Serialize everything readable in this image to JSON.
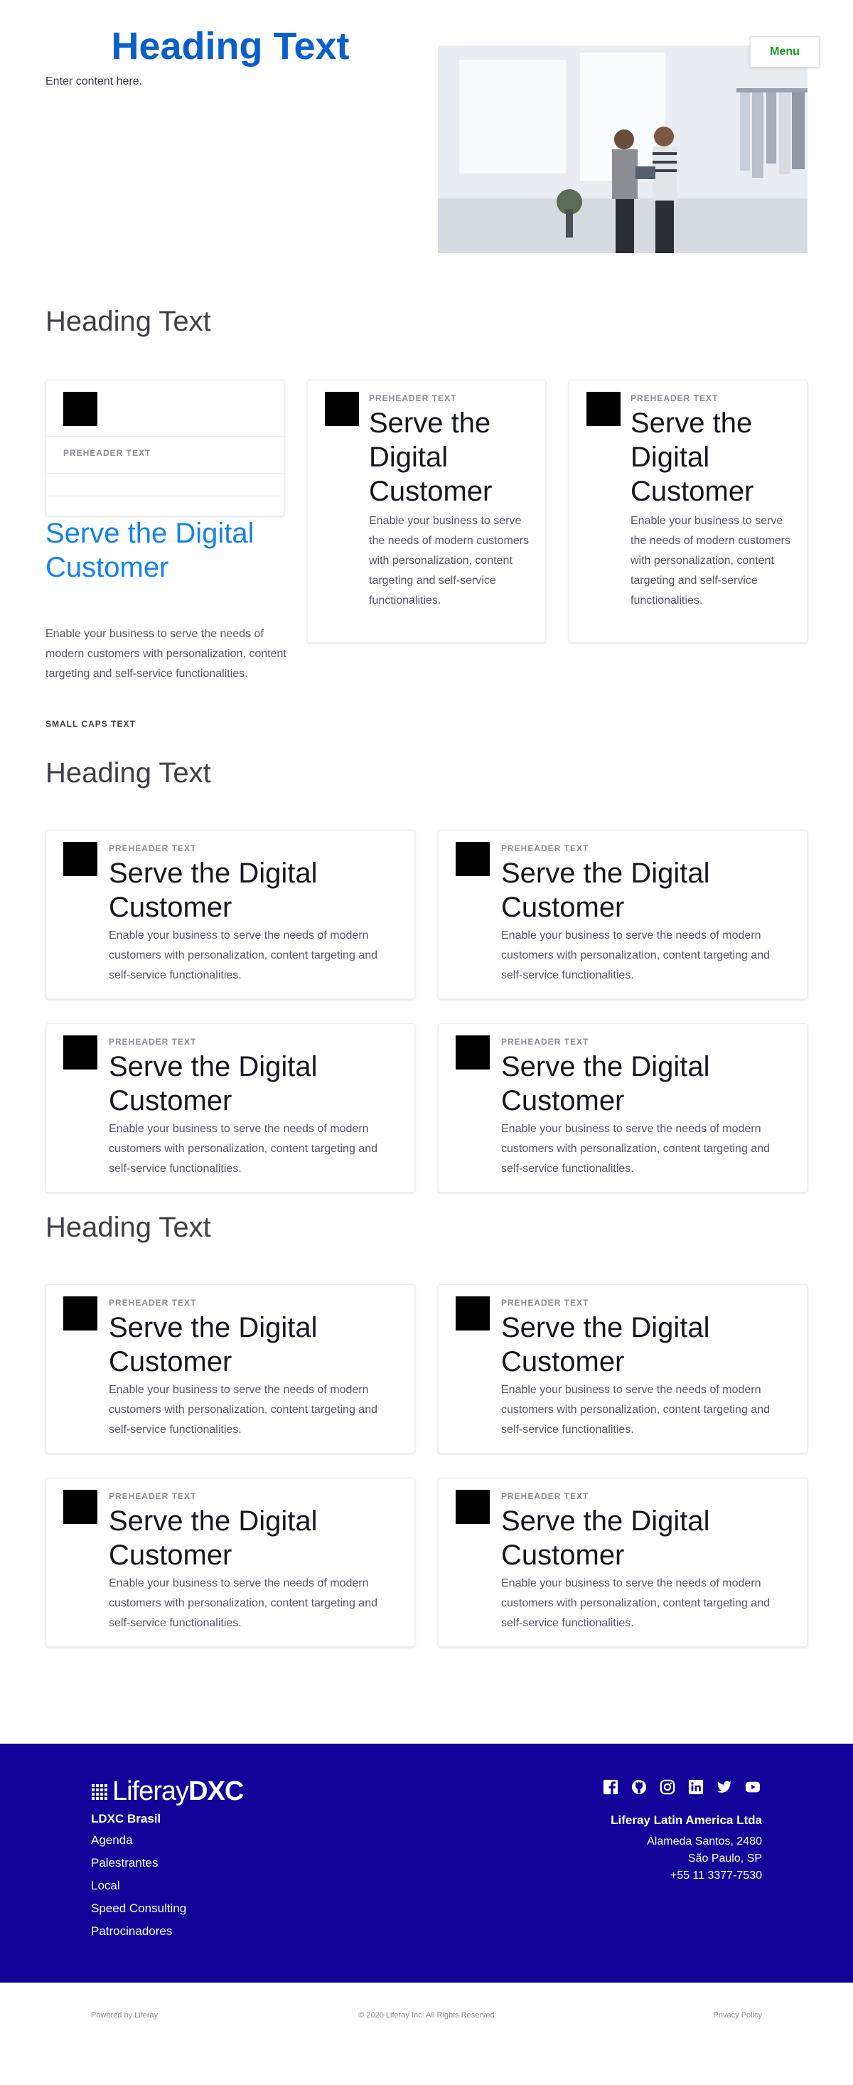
{
  "hero": {
    "title": "Heading Text",
    "body": "Enter content here.",
    "menu_label": "Menu"
  },
  "sections": [
    {
      "heading": "Heading Text"
    },
    {
      "heading": "Heading Text"
    },
    {
      "heading": "Heading Text"
    }
  ],
  "card_first": {
    "preheader": "PREHEADER TEXT",
    "title": "Serve the Digital Customer",
    "description": "Enable your business to serve the needs of modern customers with personalization, content targeting and self-service functionalities.",
    "small_caps": "SMALL CAPS TEXT"
  },
  "cards": {
    "preheader": "PREHEADER TEXT",
    "title": "Serve the Digital Customer",
    "title_narrow_1": "Serve the",
    "title_narrow_2": "Digital",
    "title_narrow_3": "Customer",
    "title_wide_1": "Serve the Digital",
    "title_wide_2": "Customer",
    "description": "Enable your business to serve the needs of modern customers with personalization, content targeting and self-service functionalities."
  },
  "footer": {
    "logo_text": "Liferay",
    "logo_bold": "DXC",
    "org": "LDXC Brasil",
    "links": [
      "Agenda",
      "Palestrantes",
      "Local",
      "Speed Consulting",
      "Patrocinadores"
    ],
    "company": "Liferay Latin America Ltda",
    "address_1": "Alameda Santos, 2480",
    "address_2": "São Paulo, SP",
    "phone": "+55 11 3377-7530",
    "social_icons": [
      "facebook-icon",
      "github-icon",
      "instagram-icon",
      "linkedin-icon",
      "twitter-icon",
      "youtube-icon"
    ]
  },
  "bottom": {
    "powered": "Powered by Liferay",
    "copyright": "© 2020 Liferay Inc. All Rights Reserved",
    "privacy": "Privacy Policy"
  },
  "colors": {
    "accent_blue": "#0b5fcc",
    "link_blue": "#1583e8",
    "footer_bg": "#130399",
    "menu_green": "#1a9a2a"
  }
}
